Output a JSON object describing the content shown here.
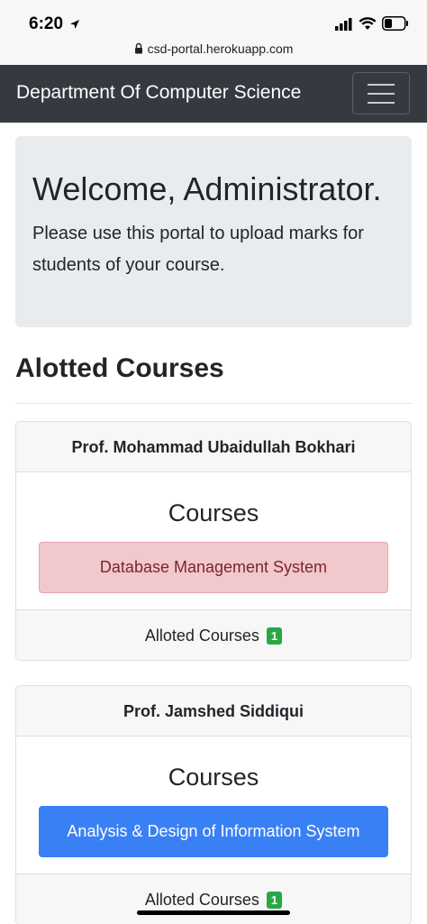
{
  "status_bar": {
    "time": "6:20",
    "url": "csd-portal.herokuapp.com",
    "icons": [
      "location-arrow-icon",
      "cellular-signal-icon",
      "wifi-icon",
      "battery-icon",
      "lock-icon"
    ]
  },
  "navbar": {
    "brand": "Department Of Computer Science",
    "toggler_icon": "hamburger-menu-icon",
    "bg_color": "#343a40"
  },
  "jumbotron": {
    "heading": "Welcome, Administrator.",
    "lead": "Please use this portal to upload marks for students of your course."
  },
  "section": {
    "title": "Alotted Courses"
  },
  "cards": [
    {
      "professor": "Prof. Mohammad Ubaidullah Bokhari",
      "body_title": "Courses",
      "course": "Database Management System",
      "footer_label": "Alloted Courses",
      "count": "1"
    },
    {
      "professor": "Prof. Jamshed Siddiqui",
      "body_title": "Courses",
      "course": "Analysis & Design of Information System",
      "footer_label": "Alloted Courses",
      "count": "1"
    }
  ],
  "colors": {
    "danger_light": "#f1c9cd",
    "primary": "#3a80f5",
    "badge_success": "#28a745"
  }
}
